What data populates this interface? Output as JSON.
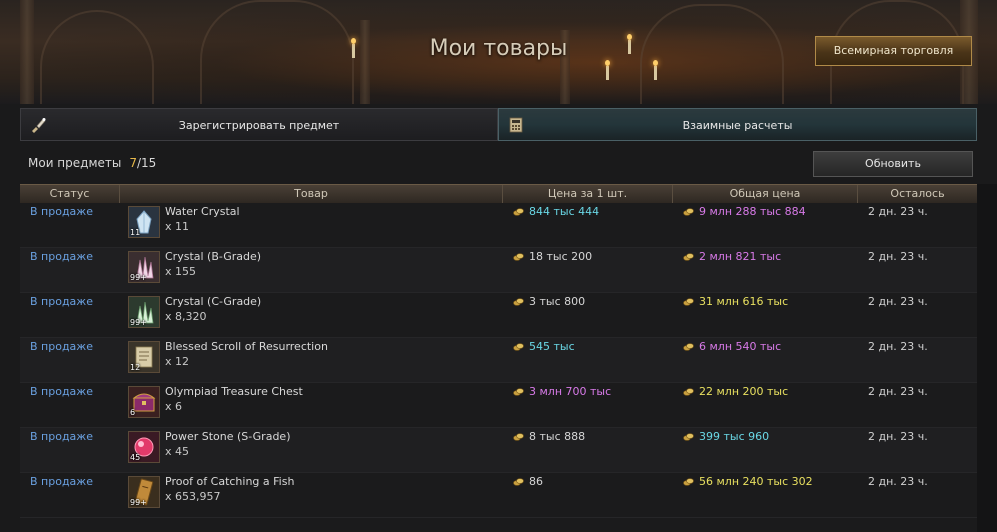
{
  "header": {
    "title": "Мои товары",
    "world_trade_button": "Всемирная торговля"
  },
  "tabs": [
    {
      "label": "Зарегистрировать предмет",
      "icon": "brush-icon",
      "active": false
    },
    {
      "label": "Взаимные расчеты",
      "icon": "calculator-icon",
      "active": true
    }
  ],
  "inventory": {
    "label": "Мои предметы",
    "count": "7",
    "max": "/15"
  },
  "refresh_button": "Обновить",
  "columns": {
    "status": "Статус",
    "item": "Товар",
    "unit_price": "Цена за 1 шт.",
    "total_price": "Общая цена",
    "remaining": "Осталось"
  },
  "rows": [
    {
      "status": "В продаже",
      "name": "Water Crystal",
      "qty": "x 11",
      "badge": "11",
      "icon": "water-crystal-icon",
      "unit_price": "844 тыс 444",
      "unit_color": "cyan",
      "total": "9 млн 288 тыс 884",
      "total_color": "pink",
      "remaining": "2 дн. 23 ч."
    },
    {
      "status": "В продаже",
      "name": "Crystal (B-Grade)",
      "qty": "x 155",
      "badge": "99+",
      "icon": "crystal-b-grade-icon",
      "unit_price": "18 тыс 200",
      "unit_color": "white",
      "total": "2 млн 821 тыс",
      "total_color": "pink",
      "remaining": "2 дн. 23 ч."
    },
    {
      "status": "В продаже",
      "name": "Crystal (C-Grade)",
      "qty": "x 8,320",
      "badge": "99+",
      "icon": "crystal-c-grade-icon",
      "unit_price": "3 тыс 800",
      "unit_color": "white",
      "total": "31 млн 616 тыс",
      "total_color": "yellow",
      "remaining": "2 дн. 23 ч."
    },
    {
      "status": "В продаже",
      "name": "Blessed Scroll of Resurrection",
      "qty": "x 12",
      "badge": "12",
      "icon": "scroll-icon",
      "unit_price": "545 тыс",
      "unit_color": "cyan",
      "total": "6 млн 540 тыс",
      "total_color": "pink",
      "remaining": "2 дн. 23 ч."
    },
    {
      "status": "В продаже",
      "name": "Olympiad Treasure Chest",
      "qty": "x 6",
      "badge": "6",
      "icon": "treasure-chest-icon",
      "unit_price": "3 млн 700 тыс",
      "unit_color": "pink",
      "total": "22 млн 200 тыс",
      "total_color": "yellow",
      "remaining": "2 дн. 23 ч."
    },
    {
      "status": "В продаже",
      "name": "Power Stone (S-Grade)",
      "qty": "x 45",
      "badge": "45",
      "icon": "power-stone-icon",
      "unit_price": "8 тыс 888",
      "unit_color": "white",
      "total": "399 тыс 960",
      "total_color": "cyan",
      "remaining": "2 дн. 23 ч."
    },
    {
      "status": "В продаже",
      "name": "Proof of Catching a Fish",
      "qty": "x 653,957",
      "badge": "99+",
      "icon": "fish-proof-icon",
      "unit_price": "86",
      "unit_color": "white",
      "total": "56 млн 240 тыс 302",
      "total_color": "yellow",
      "remaining": "2 дн. 23 ч."
    }
  ],
  "colors": {
    "white": "#d6d6d6",
    "cyan": "#6ad8e6",
    "pink": "#d87ae8",
    "yellow": "#e8e060",
    "status": "#6aa0e0",
    "accent_gold": "#e6b84a"
  }
}
